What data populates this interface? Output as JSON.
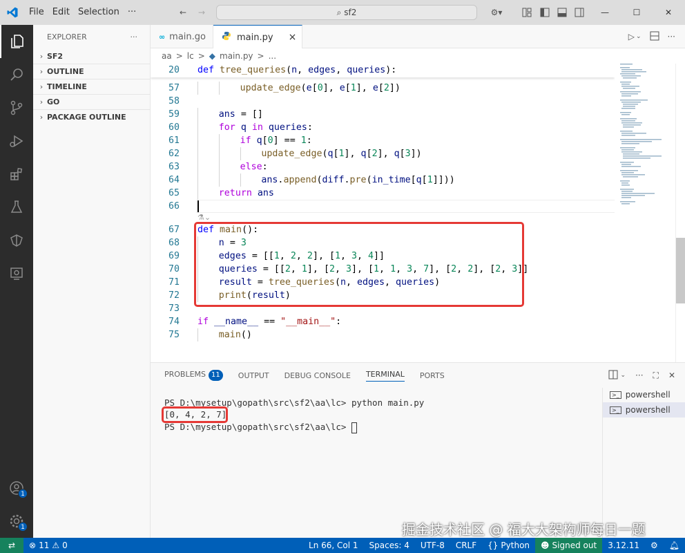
{
  "titlebar": {
    "menus": [
      "File",
      "Edit",
      "Selection",
      "···"
    ],
    "search": "sf2"
  },
  "sidebar": {
    "title": "EXPLORER",
    "more": "···",
    "sections": [
      "SF2",
      "OUTLINE",
      "TIMELINE",
      "GO",
      "PACKAGE OUTLINE"
    ]
  },
  "tabs": [
    {
      "label": "main.go",
      "icon": "go-file-icon"
    },
    {
      "label": "main.py",
      "icon": "python-file-icon",
      "close": "×"
    }
  ],
  "breadcrumb": [
    "aa",
    ">",
    "lc",
    ">",
    "main.py",
    ">",
    "..."
  ],
  "editor": {
    "sticky": {
      "ln": "20",
      "tokens": [
        [
          "kw",
          "def "
        ],
        [
          "fn",
          "tree_queries"
        ],
        [
          "",
          "("
        ],
        [
          "var",
          "n"
        ],
        [
          "",
          ", "
        ],
        [
          "var",
          "edges"
        ],
        [
          "",
          ", "
        ],
        [
          "var",
          "queries"
        ],
        [
          "",
          "):"
        ]
      ]
    },
    "lines": [
      {
        "ln": "57",
        "indent": 2,
        "tokens": [
          [
            "fn",
            "update_edge"
          ],
          [
            "",
            "("
          ],
          [
            "var",
            "e"
          ],
          [
            "",
            "["
          ],
          [
            "num",
            "0"
          ],
          [
            "",
            "], "
          ],
          [
            "var",
            "e"
          ],
          [
            "",
            "["
          ],
          [
            "num",
            "1"
          ],
          [
            "",
            "], "
          ],
          [
            "var",
            "e"
          ],
          [
            "",
            "["
          ],
          [
            "num",
            "2"
          ],
          [
            "",
            "])"
          ]
        ]
      },
      {
        "ln": "58",
        "indent": 0,
        "tokens": []
      },
      {
        "ln": "59",
        "indent": 1,
        "tokens": [
          [
            "var",
            "ans"
          ],
          [
            "",
            " = []"
          ]
        ]
      },
      {
        "ln": "60",
        "indent": 1,
        "tokens": [
          [
            "kw2",
            "for "
          ],
          [
            "var",
            "q"
          ],
          [
            "kw2",
            " in "
          ],
          [
            "var",
            "queries"
          ],
          [
            "",
            ":"
          ]
        ]
      },
      {
        "ln": "61",
        "indent": 2,
        "tokens": [
          [
            "kw2",
            "if "
          ],
          [
            "var",
            "q"
          ],
          [
            "",
            "["
          ],
          [
            "num",
            "0"
          ],
          [
            "",
            "] == "
          ],
          [
            "num",
            "1"
          ],
          [
            "",
            ":"
          ]
        ]
      },
      {
        "ln": "62",
        "indent": 3,
        "tokens": [
          [
            "fn",
            "update_edge"
          ],
          [
            "",
            "("
          ],
          [
            "var",
            "q"
          ],
          [
            "",
            "["
          ],
          [
            "num",
            "1"
          ],
          [
            "",
            "], "
          ],
          [
            "var",
            "q"
          ],
          [
            "",
            "["
          ],
          [
            "num",
            "2"
          ],
          [
            "",
            "], "
          ],
          [
            "var",
            "q"
          ],
          [
            "",
            "["
          ],
          [
            "num",
            "3"
          ],
          [
            "",
            "])"
          ]
        ]
      },
      {
        "ln": "63",
        "indent": 2,
        "tokens": [
          [
            "kw2",
            "else"
          ],
          [
            "",
            ":"
          ]
        ]
      },
      {
        "ln": "64",
        "indent": 3,
        "tokens": [
          [
            "var",
            "ans"
          ],
          [
            "",
            "."
          ],
          [
            "fn",
            "append"
          ],
          [
            "",
            "("
          ],
          [
            "var",
            "diff"
          ],
          [
            "",
            "."
          ],
          [
            "fn",
            "pre"
          ],
          [
            "",
            "("
          ],
          [
            "var",
            "in_time"
          ],
          [
            "",
            "["
          ],
          [
            "var",
            "q"
          ],
          [
            "",
            "["
          ],
          [
            "num",
            "1"
          ],
          [
            "",
            "]]))"
          ]
        ]
      },
      {
        "ln": "65",
        "indent": 1,
        "tokens": [
          [
            "kw2",
            "return "
          ],
          [
            "var",
            "ans"
          ]
        ]
      },
      {
        "ln": "66",
        "indent": 0,
        "tokens": []
      },
      {
        "ln": "67",
        "indent": 0,
        "tokens": [
          [
            "kw",
            "def "
          ],
          [
            "fn",
            "main"
          ],
          [
            "",
            "():"
          ]
        ]
      },
      {
        "ln": "68",
        "indent": 1,
        "tokens": [
          [
            "var",
            "n"
          ],
          [
            "",
            " = "
          ],
          [
            "num",
            "3"
          ]
        ]
      },
      {
        "ln": "69",
        "indent": 1,
        "tokens": [
          [
            "var",
            "edges"
          ],
          [
            "",
            " = [["
          ],
          [
            "num",
            "1"
          ],
          [
            "",
            ", "
          ],
          [
            "num",
            "2"
          ],
          [
            "",
            ", "
          ],
          [
            "num",
            "2"
          ],
          [
            "",
            "], ["
          ],
          [
            "num",
            "1"
          ],
          [
            "",
            ", "
          ],
          [
            "num",
            "3"
          ],
          [
            "",
            ", "
          ],
          [
            "num",
            "4"
          ],
          [
            "",
            "]]"
          ]
        ]
      },
      {
        "ln": "70",
        "indent": 1,
        "tokens": [
          [
            "var",
            "queries"
          ],
          [
            "",
            " = [["
          ],
          [
            "num",
            "2"
          ],
          [
            "",
            ", "
          ],
          [
            "num",
            "1"
          ],
          [
            "",
            "], ["
          ],
          [
            "num",
            "2"
          ],
          [
            "",
            ", "
          ],
          [
            "num",
            "3"
          ],
          [
            "",
            "], ["
          ],
          [
            "num",
            "1"
          ],
          [
            "",
            ", "
          ],
          [
            "num",
            "1"
          ],
          [
            "",
            ", "
          ],
          [
            "num",
            "3"
          ],
          [
            "",
            ", "
          ],
          [
            "num",
            "7"
          ],
          [
            "",
            "], ["
          ],
          [
            "num",
            "2"
          ],
          [
            "",
            ", "
          ],
          [
            "num",
            "2"
          ],
          [
            "",
            "], ["
          ],
          [
            "num",
            "2"
          ],
          [
            "",
            ", "
          ],
          [
            "num",
            "3"
          ],
          [
            "",
            "]]"
          ]
        ]
      },
      {
        "ln": "71",
        "indent": 1,
        "tokens": [
          [
            "var",
            "result"
          ],
          [
            "",
            " = "
          ],
          [
            "fn",
            "tree_queries"
          ],
          [
            "",
            "("
          ],
          [
            "var",
            "n"
          ],
          [
            "",
            ", "
          ],
          [
            "var",
            "edges"
          ],
          [
            "",
            ", "
          ],
          [
            "var",
            "queries"
          ],
          [
            "",
            ")"
          ]
        ]
      },
      {
        "ln": "72",
        "indent": 1,
        "tokens": [
          [
            "fn",
            "print"
          ],
          [
            "",
            "("
          ],
          [
            "var",
            "result"
          ],
          [
            "",
            ")"
          ]
        ]
      },
      {
        "ln": "73",
        "indent": 0,
        "tokens": []
      },
      {
        "ln": "74",
        "indent": 0,
        "tokens": [
          [
            "kw2",
            "if "
          ],
          [
            "var",
            "__name__"
          ],
          [
            "",
            " == "
          ],
          [
            "str",
            "\"__main__\""
          ],
          [
            "",
            ":"
          ]
        ]
      },
      {
        "ln": "75",
        "indent": 1,
        "tokens": [
          [
            "fn",
            "main"
          ],
          [
            "",
            "()"
          ]
        ]
      }
    ]
  },
  "panel": {
    "tabs": [
      "PROBLEMS",
      "OUTPUT",
      "DEBUG CONSOLE",
      "TERMINAL",
      "PORTS"
    ],
    "problems_count": "11",
    "active_tab": "TERMINAL",
    "terminal": {
      "line1_prompt": "PS D:\\mysetup\\gopath\\src\\sf2\\aa\\lc> ",
      "line1_cmd": "python main.py",
      "output": "[0, 4, 2, 7]",
      "line3_prompt": "PS D:\\mysetup\\gopath\\src\\sf2\\aa\\lc> "
    },
    "terminals": [
      "powershell",
      "powershell"
    ]
  },
  "statusbar": {
    "errors": "11",
    "warnings": "0",
    "position": "Ln 66, Col 1",
    "spaces": "Spaces: 4",
    "encoding": "UTF-8",
    "eol": "CRLF",
    "language": "Python",
    "signed": "Signed out",
    "version": "3.12.11"
  },
  "activity_badges": {
    "accounts": "1",
    "manage": "1"
  },
  "watermark": "掘金技术社区 @ 福大大架构师每日一题",
  "colors": {
    "accent": "#005fb8",
    "highlight_box": "#e53935",
    "activity_bg": "#2c2c2c"
  }
}
